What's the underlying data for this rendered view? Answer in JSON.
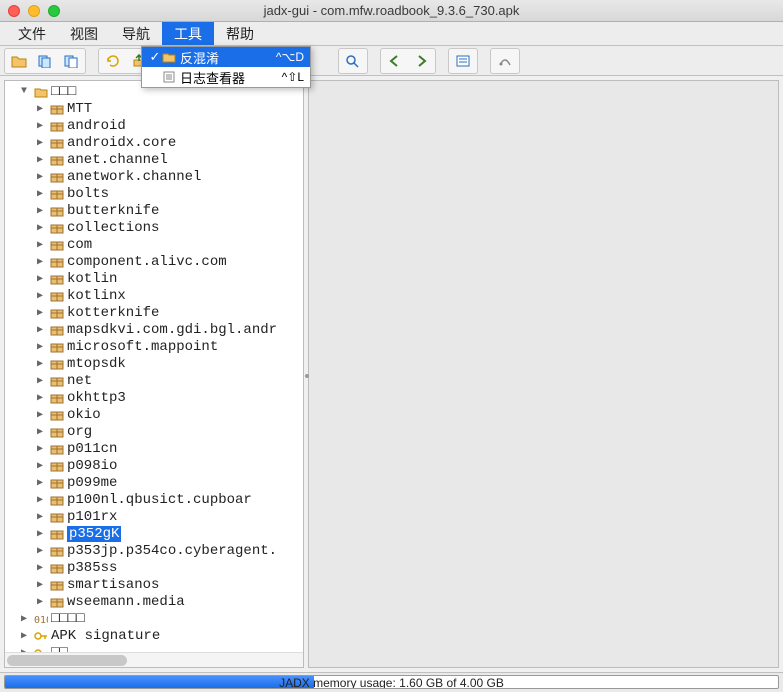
{
  "window": {
    "title": "jadx-gui - com.mfw.roadbook_9.3.6_730.apk"
  },
  "menubar": {
    "items": [
      {
        "label": "文件",
        "active": false
      },
      {
        "label": "视图",
        "active": false
      },
      {
        "label": "导航",
        "active": false
      },
      {
        "label": "工具",
        "active": true
      },
      {
        "label": "帮助",
        "active": false
      }
    ]
  },
  "dropdown": {
    "items": [
      {
        "label": "反混淆",
        "shortcut": "^⌥D",
        "checked": true,
        "selected": true,
        "icon": "deobfuscate"
      },
      {
        "label": "日志查看器",
        "shortcut": "^⇧L",
        "checked": false,
        "selected": false,
        "icon": "log"
      }
    ]
  },
  "tree": {
    "root_extra1": {
      "label": "□□□",
      "icon": "folder-open"
    },
    "packages": [
      "MTT",
      "android",
      "androidx.core",
      "anet.channel",
      "anetwork.channel",
      "bolts",
      "butterknife",
      "collections",
      "com",
      "component.alivc.com",
      "kotlin",
      "kotlinx",
      "kotterknife",
      "mapsdkvi.com.gdi.bgl.andr",
      "microsoft.mappoint",
      "mtopsdk",
      "net",
      "okhttp3",
      "okio",
      "org",
      "p011cn",
      "p098io",
      "p099me",
      "p100nl.qbusict.cupboar",
      "p101rx",
      "p352gK",
      "p353jp.p354co.cyberagent.",
      "p385ss",
      "smartisanos",
      "wseemann.media"
    ],
    "selected_index": 25,
    "tail": [
      {
        "label": "□□□□",
        "icon": "code"
      },
      {
        "label": "APK signature",
        "icon": "key"
      },
      {
        "label": "□□",
        "icon": "key"
      }
    ]
  },
  "status": {
    "text": "JADX memory usage: 1.60 GB of 4.00 GB",
    "percent": 40
  }
}
